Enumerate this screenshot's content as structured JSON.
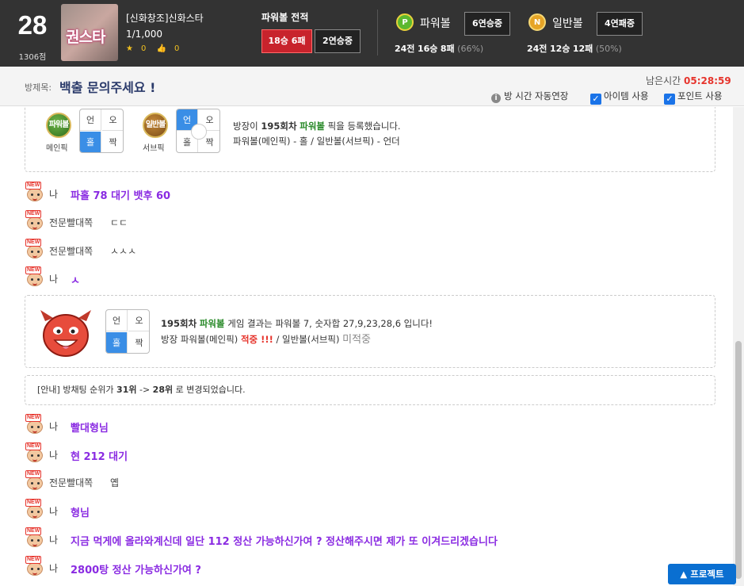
{
  "header": {
    "level": "28",
    "points": "1306점",
    "room_thumb_title": "권스타",
    "room_name": "[신화창조]신화스타",
    "member_count": "1/1,000",
    "stars": "0",
    "likes": "0",
    "powerball_record_title": "파워볼 전적",
    "record_main": "18승 6패",
    "record_streak": "2연승중",
    "powerball": {
      "ball": "P",
      "label": "파워볼",
      "streak": "6연승중",
      "games": "24전",
      "wins": "16승",
      "losses": "8패",
      "pct": "(66%)"
    },
    "normalball": {
      "ball": "N",
      "label": "일반볼",
      "streak": "4연패중",
      "games": "24전",
      "wins": "12승",
      "losses": "12패",
      "pct": "(50%)"
    }
  },
  "subbar": {
    "subject_label": "방제목:",
    "subject": "백출 문의주세요 !",
    "remain_label": "남은시간",
    "remain_time": "05:28:59",
    "auto_extend": "방 시간 자동연장",
    "item_use": "아이템 사용",
    "point_use": "포인트 사용"
  },
  "pick_card": {
    "main_ball": "파워볼",
    "main_label": "메인픽",
    "sub_ball": "일반볼",
    "sub_label": "서브픽",
    "grid_tl": "언",
    "grid_tr": "오",
    "grid_bl": "홀",
    "grid_br": "짝",
    "line1_pre": "방장이",
    "line1_round": "195회차",
    "line1_game": "파워볼",
    "line1_post": "픽을 등록했습니다.",
    "line2": "파워볼(메인픽) - 홀 / 일반볼(서브픽) - 언더"
  },
  "result_card": {
    "grid_tl": "언",
    "grid_tr": "오",
    "grid_bl": "홀",
    "grid_br": "짝",
    "round": "195회차",
    "game": "파워볼",
    "line1_post": "게임 결과는 파워볼 7, 숫자합 27,9,23,28,6 입니다!",
    "line2_pre": "방장 파워볼(메인픽)",
    "hit": "적중 !!!",
    "line2_mid": "/ 일반볼(서브픽)",
    "miss": "미적중"
  },
  "notice": {
    "prefix": "[안내] 방채팅 순위가",
    "from": "31위",
    "arrow": "->",
    "to": "28위",
    "suffix": "로 변경되었습니다."
  },
  "new_badge": "NEW",
  "messages": [
    {
      "nick": "나",
      "text": "파홀 78 대기 뱃후 60",
      "me": true
    },
    {
      "nick": "전문빨대쪽",
      "text": "ㄷㄷ",
      "me": false
    },
    {
      "nick": "전문빨대쪽",
      "text": "ㅅㅅㅅ",
      "me": false
    },
    {
      "nick": "나",
      "text": "ㅅ",
      "me": true
    },
    {
      "nick": "나",
      "text": "빨대형님",
      "me": true
    },
    {
      "nick": "나",
      "text": "현 212 대기",
      "me": true
    },
    {
      "nick": "전문빨대쪽",
      "text": "옙",
      "me": false
    },
    {
      "nick": "나",
      "text": "형님",
      "me": true
    },
    {
      "nick": "나",
      "text": "지금 먹게에 올라와계신데 일단 112 정산 가능하신가여 ? 정산해주시면 제가 또 이겨드리겠습니다",
      "me": true
    },
    {
      "nick": "나",
      "text": "2800탕 정산 가능하신가여 ?",
      "me": true
    }
  ],
  "project_button": "프로젝트"
}
